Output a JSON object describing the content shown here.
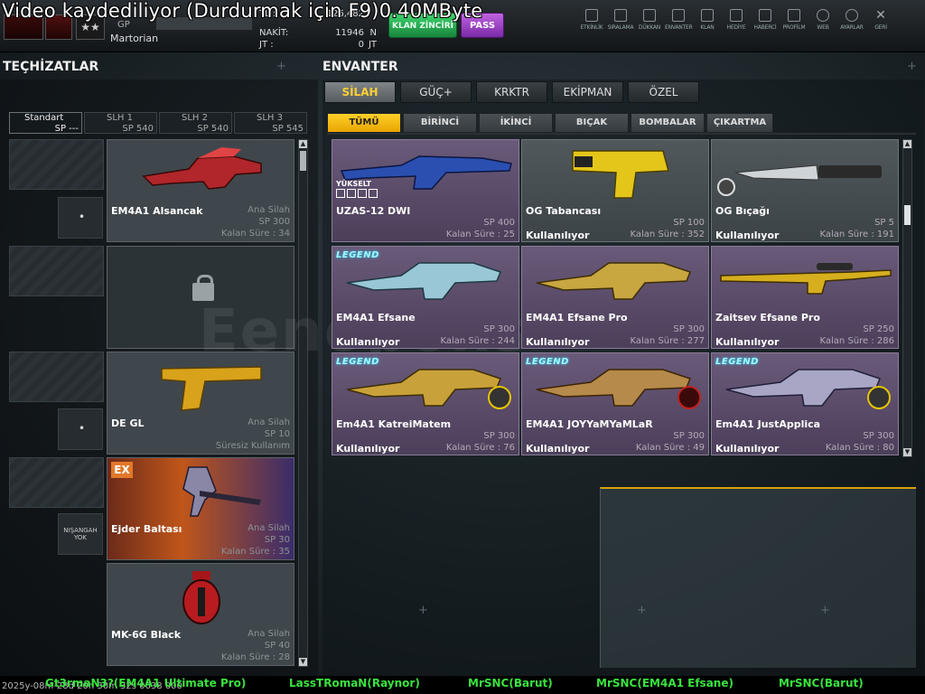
{
  "overlay": {
    "recording": "Video kaydediliyor (Durdurmak için F9)0.40MByte"
  },
  "player": {
    "name": "Martorian",
    "gp_label": "GP",
    "rank_text": "★★",
    "stats": [
      {
        "label": "TL  :",
        "value": "126,482",
        "unit": ""
      },
      {
        "label": "NAKİT:",
        "value": "11946",
        "unit": "N"
      },
      {
        "label": "JT   :",
        "value": "0",
        "unit": "JT"
      }
    ]
  },
  "topbar": {
    "green_button": "KLAN ZİNCİRİ",
    "pass_button": "PASS"
  },
  "nav": [
    {
      "label": "ETKİNLİK",
      "icon": "event-icon"
    },
    {
      "label": "SIRALAMA",
      "icon": "ranking-icon"
    },
    {
      "label": "DÜKKAN",
      "icon": "cart-icon"
    },
    {
      "label": "ENVANTER",
      "icon": "inventory-icon"
    },
    {
      "label": "KLAN",
      "icon": "clan-icon"
    },
    {
      "label": "HEDİYE",
      "icon": "gift-icon"
    },
    {
      "label": "HABERCİ",
      "icon": "megaphone-icon"
    },
    {
      "label": "PROFİLM",
      "icon": "profile-icon"
    },
    {
      "label": "WEB",
      "icon": "globe-icon"
    },
    {
      "label": "AYARLAR",
      "icon": "gear-icon"
    },
    {
      "label": "GERİ",
      "icon": "back-icon"
    }
  ],
  "equipment": {
    "title": "TEÇHİZATLAR",
    "slot_tabs": [
      {
        "label": "Standart",
        "sp": "SP ---"
      },
      {
        "label": "SLH 1",
        "sp": "SP 540"
      },
      {
        "label": "SLH 2",
        "sp": "SP 540"
      },
      {
        "label": "SLH 3",
        "sp": "SP 545"
      }
    ],
    "items": [
      {
        "name": "EM4A1 Alsancak",
        "kind": "Ana Silah",
        "sp": "SP 300",
        "remaining": "Kalan Süre : 34"
      },
      {
        "name": "",
        "kind": "",
        "sp": "",
        "remaining": ""
      },
      {
        "name": "DE GL",
        "kind": "Ana Silah",
        "sp": "SP 10",
        "remaining": "Süresiz Kullanım"
      },
      {
        "name": "Ejder Baltası",
        "kind": "Ana Silah",
        "sp": "SP 30",
        "remaining": "Kalan Süre : 35"
      },
      {
        "name": "MK-6G Black",
        "kind": "Ana Silah",
        "sp": "SP 40",
        "remaining": "Kalan Süre : 28"
      }
    ],
    "ex_badge": "EX",
    "scope_label": "NIŞANGAH YOK"
  },
  "inventory": {
    "title": "ENVANTER",
    "main_tabs": [
      "SİLAH",
      "GÜÇ+",
      "KRKTR",
      "EKİPMAN",
      "ÖZEL"
    ],
    "sub_tabs": [
      "TÜMÜ",
      "BİRİNCİ",
      "İKİNCİ",
      "BIÇAK",
      "BOMBALAR",
      "ÇIKARTMA"
    ],
    "legend_tag": "LEGEND",
    "upgrade_tag": "YÜKSELT",
    "items": [
      {
        "name": "UZAS-12 DWI",
        "sp": "SP 400",
        "status": "",
        "remaining": "Kalan Süre : 25"
      },
      {
        "name": "OG Tabancası",
        "sp": "SP 100",
        "status": "Kullanılıyor",
        "remaining": "Kalan Süre : 352"
      },
      {
        "name": "OG Bıçağı",
        "sp": "SP 5",
        "status": "Kullanılıyor",
        "remaining": "Kalan Süre : 191"
      },
      {
        "name": "EM4A1 Efsane",
        "sp": "SP 300",
        "status": "Kullanılıyor",
        "remaining": "Kalan Süre : 244"
      },
      {
        "name": "EM4A1 Efsane Pro",
        "sp": "SP 300",
        "status": "Kullanılıyor",
        "remaining": "Kalan Süre : 277"
      },
      {
        "name": "Zaitsev Efsane Pro",
        "sp": "SP 250",
        "status": "Kullanılıyor",
        "remaining": "Kalan Süre : 286"
      },
      {
        "name": "Em4A1 KatreiMatem",
        "sp": "SP 300",
        "status": "Kullanılıyor",
        "remaining": "Kalan Süre : 76"
      },
      {
        "name": "EM4A1 JOYYaMYaMLaR",
        "sp": "SP 300",
        "status": "Kullanılıyor",
        "remaining": "Kalan Süre : 49"
      },
      {
        "name": "Em4A1 JustApplica",
        "sp": "SP 300",
        "status": "Kullanılıyor",
        "remaining": "Kalan Süre : 80"
      }
    ]
  },
  "watermark": "Eenopolis",
  "ticker": {
    "system": "2025y-08m-28d 20h 30m 32s 0638 000",
    "entries": [
      "Gt3rmaN3?(EM4A1 Ultimate Pro)",
      "LassTRomaN(Raynor)",
      "MrSNC(Barut)",
      "MrSNC(EM4A1 Efsane)",
      "MrSNC(Barut)"
    ]
  }
}
